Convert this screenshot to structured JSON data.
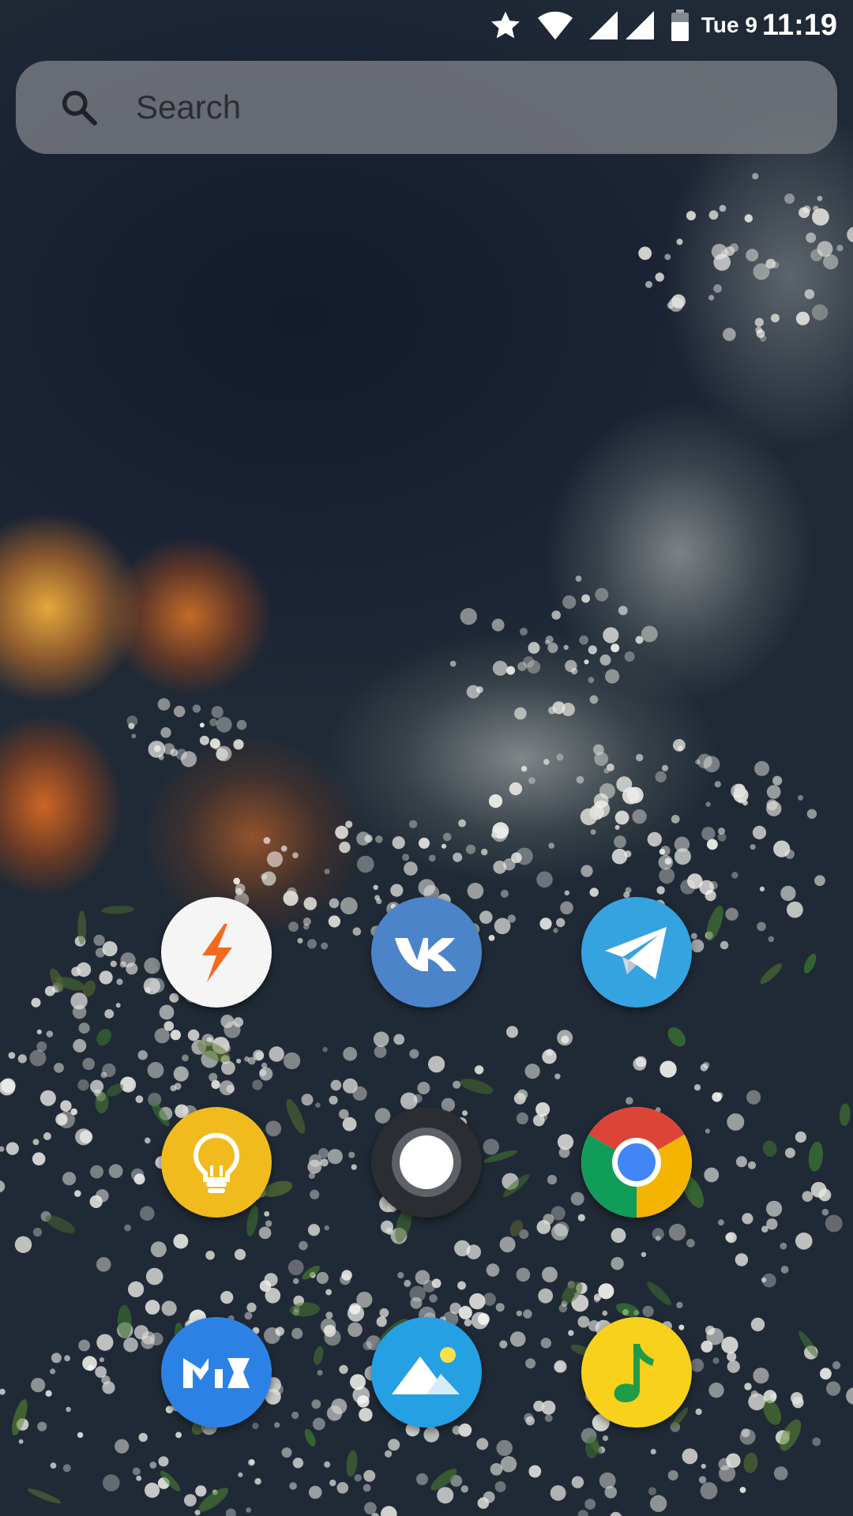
{
  "status_bar": {
    "icons": [
      "star-icon",
      "wifi-icon",
      "signal-icon",
      "signal-icon",
      "battery-icon"
    ],
    "date": "Tue 9",
    "time": "11:19"
  },
  "search": {
    "icon": "search-icon",
    "placeholder": "Search"
  },
  "apps": [
    {
      "icon": "lightning-icon",
      "color": "#f5f5f5"
    },
    {
      "icon": "vk-icon",
      "color": "#4c84c9"
    },
    {
      "icon": "telegram-icon",
      "color": "#35a3e0"
    },
    {
      "icon": "lightbulb-icon",
      "color": "#f1bb1d"
    },
    {
      "icon": "record-icon",
      "color": "#2a2e33"
    },
    {
      "icon": "chrome-icon",
      "color": "#ffffff"
    },
    {
      "icon": "mix-icon",
      "color": "#2c82e4"
    },
    {
      "icon": "gallery-icon",
      "color": "#24a0e3"
    },
    {
      "icon": "music-note-icon",
      "color": "#f7d11c"
    }
  ]
}
